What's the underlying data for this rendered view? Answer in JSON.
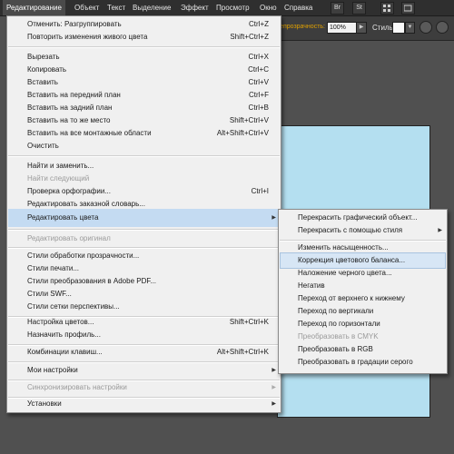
{
  "menubar": {
    "items": [
      "Редактирование",
      "Объект",
      "Текст",
      "Выделение",
      "Эффект",
      "Просмотр",
      "Окно",
      "Справка"
    ],
    "icons": [
      "br-icon",
      "st-icon",
      "grid-icon",
      "arrange-icon"
    ],
    "icon_labels": [
      "Br",
      "St",
      "",
      ""
    ]
  },
  "controlbar": {
    "opacity_label": "Непрозрачность:",
    "opacity_value": "100%",
    "style_label": "Стиль:",
    "accent_color": "#e0a000"
  },
  "edit_menu": {
    "items": [
      {
        "label": "Отменить: Разгруппировать",
        "shortcut": "Ctrl+Z"
      },
      {
        "label": "Повторить изменения живого цвета",
        "shortcut": "Shift+Ctrl+Z"
      },
      {
        "label": "Вырезать",
        "shortcut": "Ctrl+X"
      },
      {
        "label": "Копировать",
        "shortcut": "Ctrl+C"
      },
      {
        "label": "Вставить",
        "shortcut": "Ctrl+V"
      },
      {
        "label": "Вставить на передний план",
        "shortcut": "Ctrl+F"
      },
      {
        "label": "Вставить на задний план",
        "shortcut": "Ctrl+B"
      },
      {
        "label": "Вставить на то же место",
        "shortcut": "Shift+Ctrl+V"
      },
      {
        "label": "Вставить на все монтажные области",
        "shortcut": "Alt+Shift+Ctrl+V"
      },
      {
        "label": "Очистить",
        "shortcut": ""
      },
      {
        "label": "Найти и заменить...",
        "shortcut": ""
      },
      {
        "label": "Найти следующий",
        "shortcut": "",
        "disabled": true
      },
      {
        "label": "Проверка орфографии...",
        "shortcut": "Ctrl+I"
      },
      {
        "label": "Редактировать заказной словарь...",
        "shortcut": ""
      },
      {
        "label": "Редактировать цвета",
        "shortcut": "",
        "submenu": true,
        "active": true
      },
      {
        "label": "Редактировать оригинал",
        "shortcut": "",
        "disabled": true
      },
      {
        "label": "Стили обработки прозрачности...",
        "shortcut": ""
      },
      {
        "label": "Стили печати...",
        "shortcut": ""
      },
      {
        "label": "Стили преобразования в Adobe PDF...",
        "shortcut": ""
      },
      {
        "label": "Стили SWF...",
        "shortcut": ""
      },
      {
        "label": "Стили сетки перспективы...",
        "shortcut": ""
      },
      {
        "label": "Настройка цветов...",
        "shortcut": "Shift+Ctrl+K"
      },
      {
        "label": "Назначить профиль...",
        "shortcut": ""
      },
      {
        "label": "Комбинации клавиш...",
        "shortcut": "Alt+Shift+Ctrl+K"
      },
      {
        "label": "Мои настройки",
        "shortcut": "",
        "submenu": true
      },
      {
        "label": "Синхронизировать настройки",
        "shortcut": "",
        "submenu": true,
        "disabled": true
      },
      {
        "label": "Установки",
        "shortcut": "",
        "submenu": true
      }
    ]
  },
  "colors_submenu": {
    "items": [
      {
        "label": "Перекрасить графический объект..."
      },
      {
        "label": "Перекрасить с помощью стиля",
        "submenu": true
      },
      {
        "label": "Изменить насыщенность..."
      },
      {
        "label": "Коррекция цветового баланса...",
        "highlighted": true
      },
      {
        "label": "Наложение черного цвета..."
      },
      {
        "label": "Негатив"
      },
      {
        "label": "Переход от верхнего к нижнему"
      },
      {
        "label": "Переход по вертикали"
      },
      {
        "label": "Переход по горизонтали"
      },
      {
        "label": "Преобразовать в CMYK",
        "disabled": true
      },
      {
        "label": "Преобразовать в RGB"
      },
      {
        "label": "Преобразовать в градации серого"
      }
    ]
  },
  "artboard": {
    "color": "#b4dff0"
  }
}
